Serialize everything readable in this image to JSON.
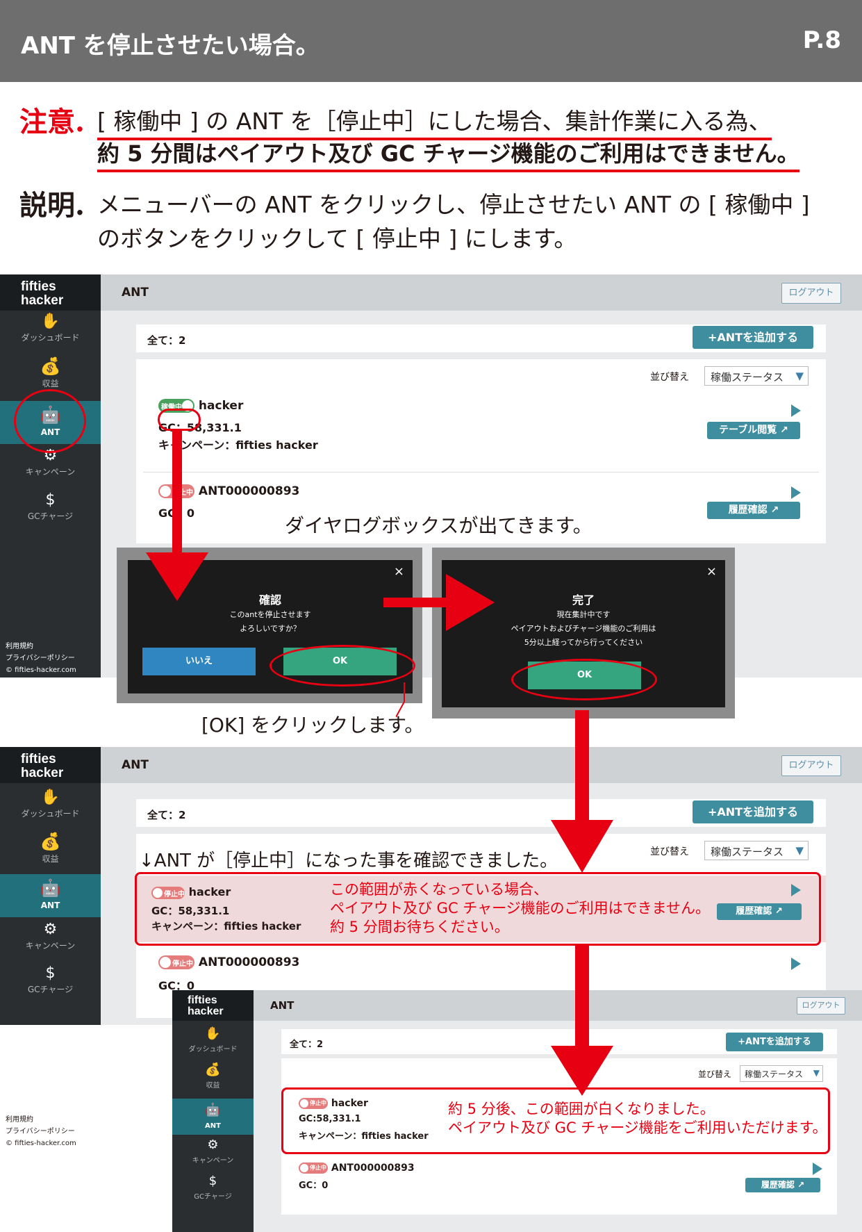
{
  "header": {
    "title": "ANT を停止させたい場合。",
    "page": "P.8"
  },
  "caution": {
    "label": "注意.",
    "line1_a": "[ 稼働中 ] の ANT を［停止中］にした場合、集計作業に入る為、",
    "line2": "約 5 分間はペイアウト及び GC チャージ機能のご利用はできません。"
  },
  "explain": {
    "label": "説明.",
    "line1": "メニューバーの ANT をクリックし、停止させたい ANT の [ 稼働中 ]",
    "line2": "のボタンをクリックして [ 停止中 ] にします。"
  },
  "app": {
    "logo_l1": "fifties",
    "logo_l2": "hacker",
    "page_title": "ANT",
    "logout": "ログアウト",
    "nav": [
      {
        "label": "ダッシュボード",
        "icon": "handshake-icon"
      },
      {
        "label": "収益",
        "icon": "money-bag-icon"
      },
      {
        "label": "ANT",
        "icon": "robot-icon"
      },
      {
        "label": "キャンペーン",
        "icon": "gear-head-icon"
      },
      {
        "label": "GCチャージ",
        "icon": "coin-hand-icon"
      }
    ],
    "footer": [
      "利用規約",
      "プライバシーポリシー",
      "© fifties-hacker.com"
    ],
    "total": "全て：2",
    "add_button": "+ANTを追加する",
    "sort_label": "並び替え",
    "sort_value": "稼働ステータス",
    "table_button": "テーブル閲覧",
    "history_button": "履歴確認",
    "status_on": "稼働中",
    "status_off": "停止中",
    "ant1_name": "hacker",
    "ant1_gc": "GC：58,331.1",
    "ant1_campaign": "キャンペーン：fifties hacker",
    "ant2_name": "ANT000000893",
    "ant2_gc": "GC：0",
    "ant1_gc_compact": "GC:58,331.1"
  },
  "annotations": {
    "dialog_appears": "ダイヤログボックスが出てきます。",
    "click_ok": "[OK] をクリックします。",
    "confirmed": "↓ANT が［停止中］になった事を確認できました。",
    "red_note": [
      "この範囲が赤くなっている場合、",
      "ペイアウト及び GC チャージ機能のご利用はできません。",
      "約 5 分間お待ちください。"
    ],
    "white_note": [
      "約 5 分後、この範囲が白くなりました。",
      "ペイアウト及び GC チャージ機能をご利用いただけます。"
    ]
  },
  "dialog_confirm": {
    "title": "確認",
    "body1": "このantを停止させます",
    "body2": "よろしいですか？",
    "no": "いいえ",
    "ok": "OK",
    "close": "×"
  },
  "dialog_done": {
    "title": "完了",
    "body1": "現在集計中です",
    "body2": "ペイアウトおよびチャージ機能のご利用は",
    "body3": "5分以上経ってから行ってください",
    "ok": "OK",
    "close": "×"
  },
  "colors": {
    "accent_red": "#e60012",
    "teal": "#3f8ea0",
    "ok_green": "#35a57f",
    "no_blue": "#2f86c0"
  }
}
